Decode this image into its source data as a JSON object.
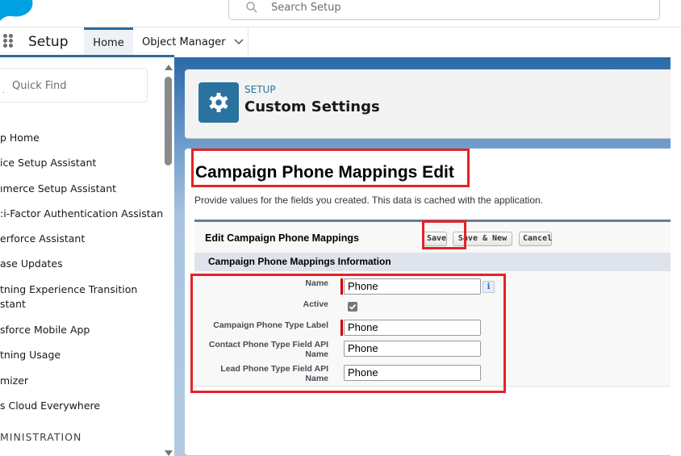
{
  "header": {
    "search_placeholder": "Search Setup"
  },
  "nav": {
    "app_name": "Setup",
    "tabs": [
      {
        "label": "Home",
        "active": true
      },
      {
        "label": "Object Manager",
        "has_dropdown": true
      }
    ]
  },
  "sidebar": {
    "quick_find_placeholder": "Quick Find",
    "items": [
      {
        "label": "p Home"
      },
      {
        "label": "ice Setup Assistant"
      },
      {
        "label": "ımerce Setup Assistant"
      },
      {
        "label": ":i-Factor Authentication Assistant"
      },
      {
        "label": "erforce Assistant"
      },
      {
        "label": "ase Updates"
      },
      {
        "label": "tning Experience Transition",
        "label2": "stant"
      },
      {
        "label": "sforce Mobile App"
      },
      {
        "label": "tning Usage"
      },
      {
        "label": "mizer"
      },
      {
        "label": "s Cloud Everywhere"
      }
    ],
    "section_label": "MINISTRATION"
  },
  "page_header": {
    "kicker": "SETUP",
    "title": "Custom Settings",
    "icon": "gear-icon"
  },
  "content": {
    "title": "Campaign Phone Mappings Edit",
    "description": "Provide values for the fields you created. This data is cached with the application.",
    "edit_block": {
      "title": "Edit Campaign Phone Mappings",
      "buttons": {
        "save": "Save",
        "save_new": "Save & New",
        "cancel": "Cancel"
      },
      "section_title": "Campaign Phone Mappings Information",
      "fields": {
        "name": {
          "label": "Name",
          "value": "Phone",
          "required": true
        },
        "active": {
          "label": "Active",
          "checked": true
        },
        "campaign_label": {
          "label": "Campaign Phone Type Label",
          "value": "Phone",
          "required": true
        },
        "contact_api": {
          "label_line1": "Contact Phone Type Field API",
          "label_line2": "Name",
          "value": "Phone"
        },
        "lead_api": {
          "label_line1": "Lead Phone Type Field API",
          "label_line2": "Name",
          "value": "Phone"
        }
      },
      "info_icon_glyph": "i"
    }
  },
  "colors": {
    "brand_blue": "#00a1e0",
    "accent": "#2a739e",
    "highlight_red": "#e52226",
    "required_red": "#cc0000"
  }
}
